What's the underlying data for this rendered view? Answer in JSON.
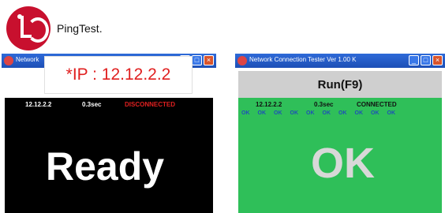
{
  "logo": {
    "brand_text": "PingTest."
  },
  "window1": {
    "title": "Network",
    "status": {
      "ip": "12.12.2.2",
      "time": "0.3sec",
      "state": "DISCONNECTED"
    },
    "big_text": "Ready",
    "callout": "*IP : 12.12.2.2"
  },
  "window2": {
    "title": "Network Connection Tester Ver 1.00 K",
    "run_button": "Run(F9)",
    "status": {
      "ip": "12.12.2.2",
      "time": "0.3sec",
      "state": "CONNECTED"
    },
    "ok_items": [
      "OK",
      "OK",
      "OK",
      "OK",
      "OK",
      "OK",
      "OK",
      "OK",
      "OK",
      "OK"
    ],
    "big_text": "OK"
  },
  "colors": {
    "disconnected": "#e02020",
    "connected_bg": "#2fbf59",
    "ok_text": "#1e4fb8"
  }
}
